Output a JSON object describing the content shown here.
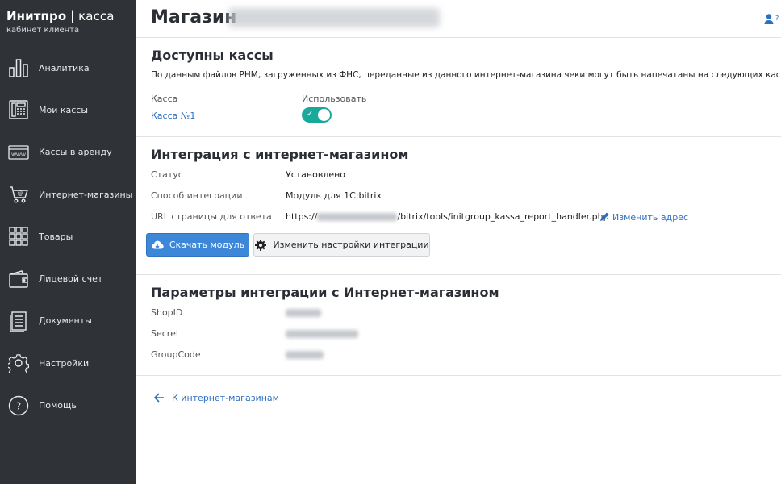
{
  "brand": {
    "title_bold": "Инитпро",
    "title_rest": " | касса",
    "subtitle": "кабинет клиента"
  },
  "sidebar": {
    "items": [
      {
        "label": "Аналитика",
        "icon": "analytics-icon"
      },
      {
        "label": "Мои кассы",
        "icon": "cash-register-icon"
      },
      {
        "label": "Кассы в аренду",
        "icon": "www-icon"
      },
      {
        "label": "Интернет-магазины",
        "icon": "cart-icon"
      },
      {
        "label": "Товары",
        "icon": "grid-icon"
      },
      {
        "label": "Лицевой счет",
        "icon": "wallet-icon"
      },
      {
        "label": "Документы",
        "icon": "documents-icon"
      },
      {
        "label": "Настройки",
        "icon": "gear-icon"
      },
      {
        "label": "Помощь",
        "icon": "help-circle-icon"
      }
    ]
  },
  "header": {
    "title": "Магазин"
  },
  "kassas": {
    "heading": "Доступны кассы",
    "description": "По данным файлов РНМ, загруженных из ФНС, переданные из данного интернет-магазина чеки могут быть напечатаны на следующих кассах.",
    "col_kassa": "Касса",
    "col_use": "Использовать",
    "rows": [
      {
        "name": "Касса №1",
        "enabled": true
      }
    ]
  },
  "integration": {
    "heading": "Интеграция с интернет-магазином",
    "status_label": "Статус",
    "status_value": "Установлено",
    "method_label": "Способ интеграции",
    "method_value": "Модуль для 1С:bitrix",
    "url_label": "URL страницы для ответа",
    "url_prefix": "https://",
    "url_suffix": "/bitrix/tools/initgroup_kassa_report_handler.php",
    "change_address": "Изменить адрес",
    "download_button": "Скачать модуль",
    "settings_button": "Изменить настройки интеграции"
  },
  "params": {
    "heading": "Параметры интеграции с Интернет-магазином",
    "shopid_label": "ShopID",
    "secret_label": "Secret",
    "groupcode_label": "GroupCode"
  },
  "back_link": "К интернет-магазинам",
  "colors": {
    "sidebar": "#2f3237",
    "accent": "#3d87d9",
    "toggle": "#18a99a",
    "link": "#2f6fc0"
  }
}
